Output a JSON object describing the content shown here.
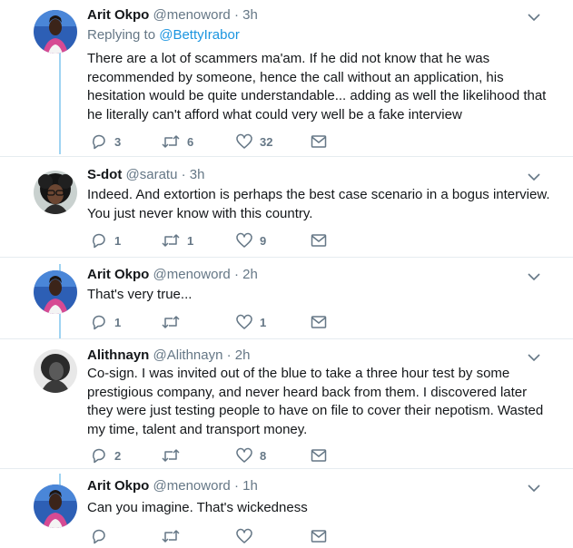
{
  "thread": {
    "tweets": [
      {
        "name": "Arit Okpo",
        "handle": "@menoword",
        "time": "3h",
        "reply_prefix": "Replying to",
        "reply_to": "@BettyIrabor",
        "text": "There are a lot of scammers ma'am. If he did not know that he was recommended by someone, hence the call without an application, his hesitation would be quite understandable... adding as well the likelihood that he literally can't afford what could very well be a fake interview",
        "replies": "3",
        "retweets": "6",
        "likes": "32"
      },
      {
        "name": "S-dot",
        "handle": "@saratu",
        "time": "3h",
        "text": "Indeed. And extortion is perhaps the best case scenario in a bogus interview. You just never know with this country.",
        "replies": "1",
        "retweets": "1",
        "likes": "9"
      },
      {
        "name": "Arit Okpo",
        "handle": "@menoword",
        "time": "2h",
        "text": "That's very true...",
        "replies": "1",
        "retweets": "",
        "likes": "1"
      },
      {
        "name": "Alithnayn",
        "handle": "@Alithnayn",
        "time": "2h",
        "text": "Co-sign. I was invited out of the blue to take a three hour test by some prestigious company, and never heard back from them. I discovered later they were just testing people to have on file to cover their nepotism. Wasted my time, talent and transport money.",
        "replies": "2",
        "retweets": "",
        "likes": "8"
      },
      {
        "name": "Arit Okpo",
        "handle": "@menoword",
        "time": "1h",
        "text": "Can you imagine. That's wickedness",
        "replies": "",
        "retweets": "",
        "likes": ""
      }
    ],
    "separator": "·"
  },
  "colors": {
    "thread_line": "#9fd3f2",
    "link": "#1b95e0",
    "muted": "#657786",
    "text": "#14171a"
  },
  "icons": [
    "reply-icon",
    "retweet-icon",
    "like-icon",
    "direct-message-icon",
    "caret-down-icon",
    "avatar"
  ]
}
